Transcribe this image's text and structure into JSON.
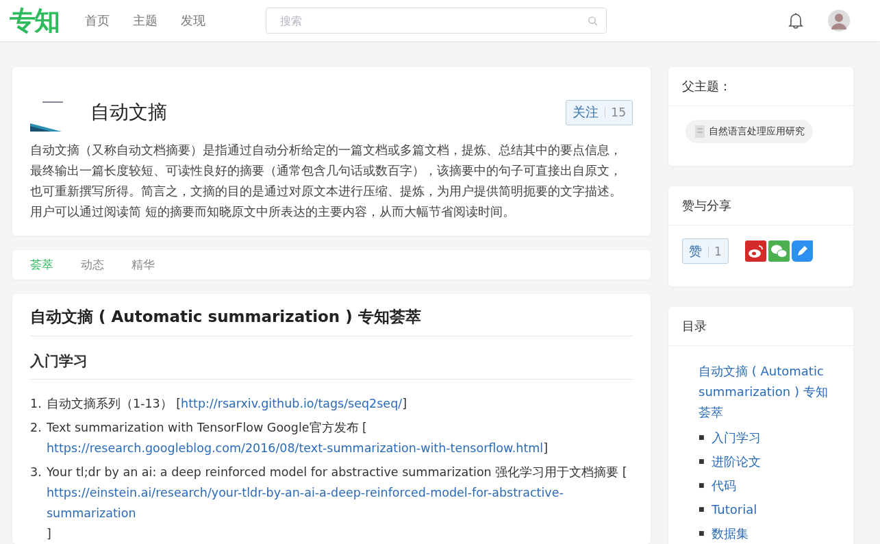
{
  "header": {
    "logo": "专知",
    "nav": [
      {
        "label": "首页",
        "selected": false
      },
      {
        "label": "主题",
        "selected": false
      },
      {
        "label": "发现",
        "selected": false
      }
    ],
    "search": {
      "placeholder": "搜索"
    }
  },
  "topic": {
    "title": "自动文摘",
    "follow": {
      "label": "关注",
      "count": "15"
    },
    "description": "自动文摘（又称自动文档摘要）是指通过自动分析给定的一篇文档或多篇文档，提炼、总结其中的要点信息，最终输出一篇长度较短、可读性良好的摘要（通常包含几句话或数百字），该摘要中的句子可直接出自原文，也可重新撰写所得。简言之，文摘的目的是通过对原文本进行压缩、提炼，为用户提供简明扼要的文字描述。用户可以通过阅读简 短的摘要而知晓原文中所表达的主要内容，从而大幅节省阅读时间。"
  },
  "tabs": [
    {
      "label": "荟萃",
      "selected": true
    },
    {
      "label": "动态",
      "selected": false
    },
    {
      "label": "精华",
      "selected": false
    }
  ],
  "article": {
    "title": "自动文摘 ( Automatic summarization ) 专知荟萃",
    "section": "入门学习",
    "items": [
      {
        "marker": "1.",
        "text": "自动文摘系列（1-13） [",
        "link": "http://rsarxiv.github.io/tags/seq2seq/",
        "tail": "]"
      },
      {
        "marker": "2.",
        "text": "Text summarization with TensorFlow Google官方发布 [",
        "link": "https://research.googleblog.com/2016/08/text-summarization-with-tensorflow.html",
        "tail": "]"
      },
      {
        "marker": "3.",
        "text": "Your tl;dr by an ai: a deep reinforced model for abstractive summarization 强化学习用于文档摘要 [",
        "link": "https://einstein.ai/research/your-tldr-by-an-ai-a-deep-reinforced-model-for-abstractive-summarization",
        "tail": "]"
      }
    ]
  },
  "parent": {
    "title": "父主题：",
    "topic": "自然语言处理应用研究"
  },
  "share": {
    "title": "赞与分享",
    "like": {
      "label": "赞",
      "count": "1"
    }
  },
  "toc": {
    "title": "目录",
    "root": "自动文摘 ( Automatic summarization ) 专知荟萃",
    "children": [
      {
        "marker": "■",
        "label": "入门学习"
      },
      {
        "marker": "■",
        "label": "进阶论文"
      },
      {
        "marker": "■",
        "label": "代码"
      },
      {
        "marker": "■",
        "label": "Tutorial"
      },
      {
        "marker": "■",
        "label": "数据集"
      }
    ]
  }
}
